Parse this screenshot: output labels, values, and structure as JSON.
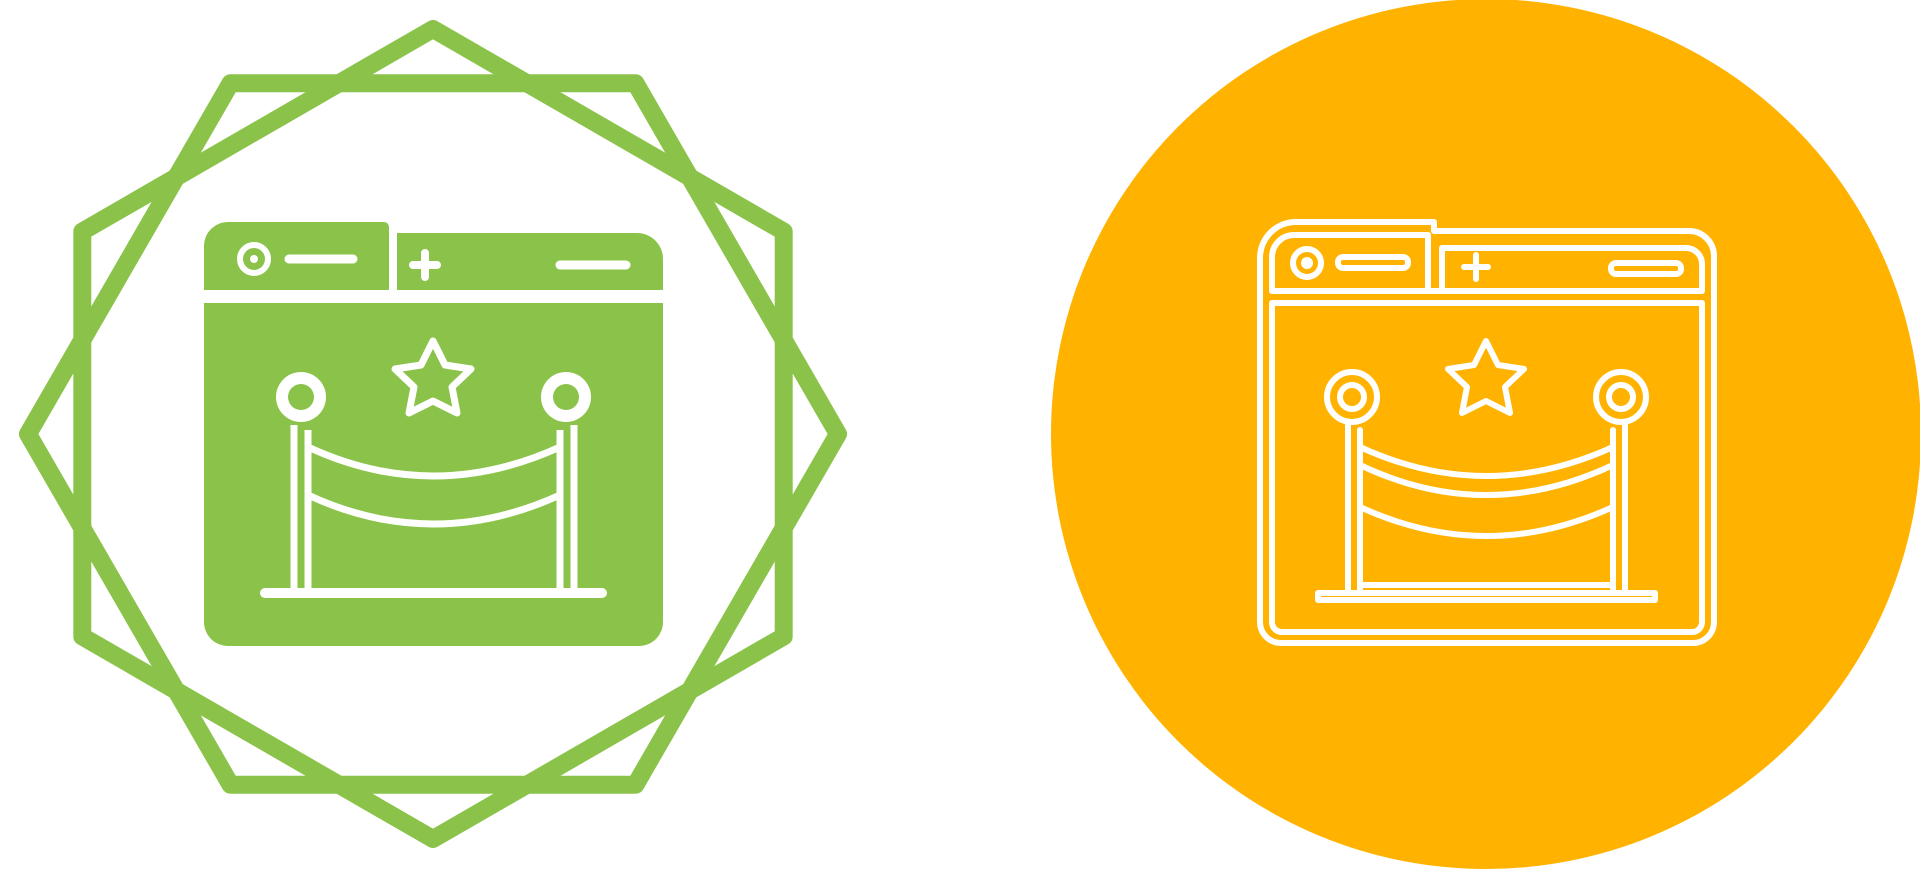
{
  "colors": {
    "green": "#8bc34a",
    "orange": "#ffb300",
    "white": "#ffffff"
  },
  "icons": {
    "glyph_variant": "red-carpet-webpage-icon",
    "line_variant": "red-carpet-webpage-icon"
  }
}
